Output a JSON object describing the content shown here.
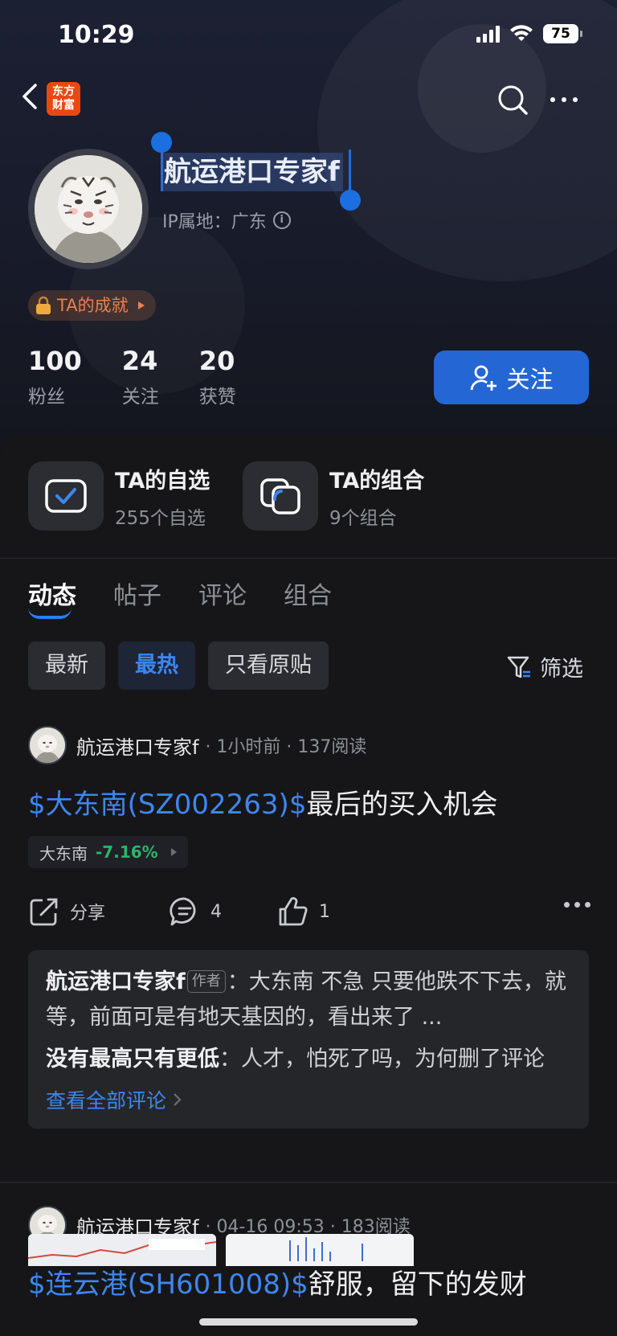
{
  "status_bar": {
    "time": "10:29",
    "battery": "75"
  },
  "app": {
    "logo_line1": "东方",
    "logo_line2": "财富"
  },
  "profile": {
    "name": "航运港口专家f",
    "ip_location": "IP属地：广东",
    "achievement": "TA的成就",
    "stats": [
      {
        "value": "100",
        "label": "粉丝"
      },
      {
        "value": "24",
        "label": "关注"
      },
      {
        "value": "20",
        "label": "获赞"
      }
    ],
    "follow_label": "关注"
  },
  "features": [
    {
      "title": "TA的自选",
      "sub": "255个自选"
    },
    {
      "title": "TA的组合",
      "sub": "9个组合"
    }
  ],
  "tabs": [
    "动态",
    "帖子",
    "评论",
    "组合"
  ],
  "filters": [
    "最新",
    "最热",
    "只看原贴"
  ],
  "filter_button": "筛选",
  "posts": [
    {
      "author": "航运港口专家f",
      "meta": "· 1小时前 · 137阅读",
      "stock_link": "$大东南(SZ002263)$",
      "title_text": "最后的买入机会",
      "stock_tag": {
        "name": "大东南",
        "change": "-7.16%"
      },
      "share": "分享",
      "comments": "4",
      "likes": "1",
      "comment_list": [
        {
          "user": "航运港口专家f",
          "tag": "作者",
          "text": "：大东南 不急 只要他跌不下去，就等，前面可是有地天基因的，看出来了",
          "ellipsis": "..."
        },
        {
          "user": "没有最高只有更低",
          "text": "：人才，怕死了吗，为何删了评论"
        }
      ],
      "see_all": "查看全部评论"
    },
    {
      "author": "航运港口专家f",
      "meta": "· 04-16 09:53 · 183阅读",
      "stock_link": "$连云港(SH601008)$",
      "title_text": "舒服，留下的发财"
    }
  ],
  "colors": {
    "accent": "#2d7cf0",
    "follow_bg": "#2467d4",
    "achievement": "#e8814f",
    "down": "#2fb36a"
  }
}
